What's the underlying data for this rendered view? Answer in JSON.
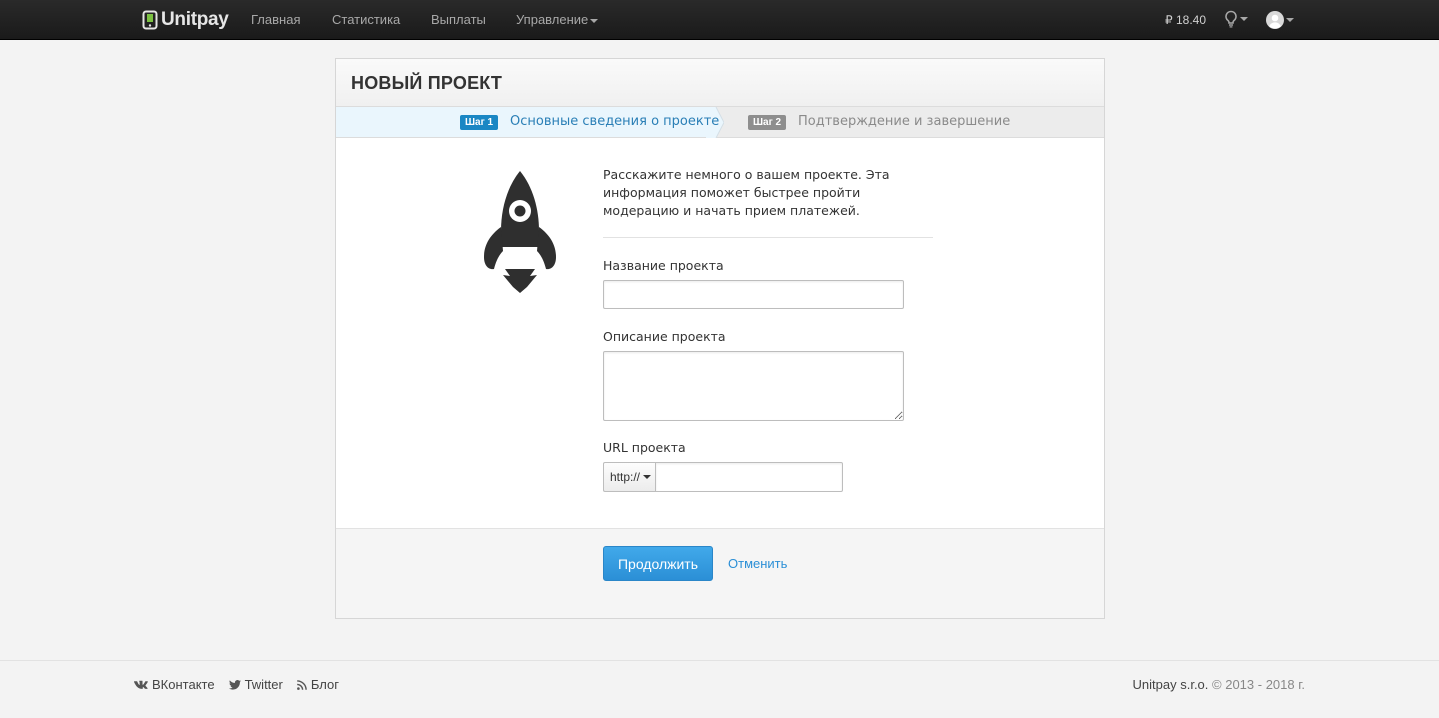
{
  "navbar": {
    "brand": "Unitpay",
    "items": [
      {
        "label": "Главная"
      },
      {
        "label": "Статистика"
      },
      {
        "label": "Выплаты"
      },
      {
        "label": "Управление"
      }
    ],
    "balance": "₽ 18.40"
  },
  "panel": {
    "title": "НОВЫЙ ПРОЕКТ",
    "steps": [
      {
        "badge": "Шаг 1",
        "label": "Основные сведения о проекте",
        "active": true
      },
      {
        "badge": "Шаг 2",
        "label": "Подтверждение и завершение",
        "active": false
      }
    ],
    "intro": "Расскажите немного о вашем проекте. Эта информация поможет быстрее пройти модерацию и начать прием платежей.",
    "fields": {
      "name_label": "Название проекта",
      "name_value": "",
      "description_label": "Описание проекта",
      "description_value": "",
      "url_label": "URL проекта",
      "url_protocol": "http://",
      "url_value": ""
    },
    "continue_button": "Продолжить",
    "cancel_link": "Отменить"
  },
  "footer": {
    "links": [
      {
        "label": "ВКонтакте",
        "icon": "vk-icon"
      },
      {
        "label": "Twitter",
        "icon": "twitter-icon"
      },
      {
        "label": "Блог",
        "icon": "rss-icon"
      }
    ],
    "company": "Unitpay s.r.o.",
    "years": "© 2013 - 2018 г."
  },
  "colors": {
    "accent": "#2b8fd6",
    "step_active_badge": "#1a87c4",
    "step_inactive_badge": "#8e8e8e",
    "navbar_bg": "#1f1f1f"
  }
}
